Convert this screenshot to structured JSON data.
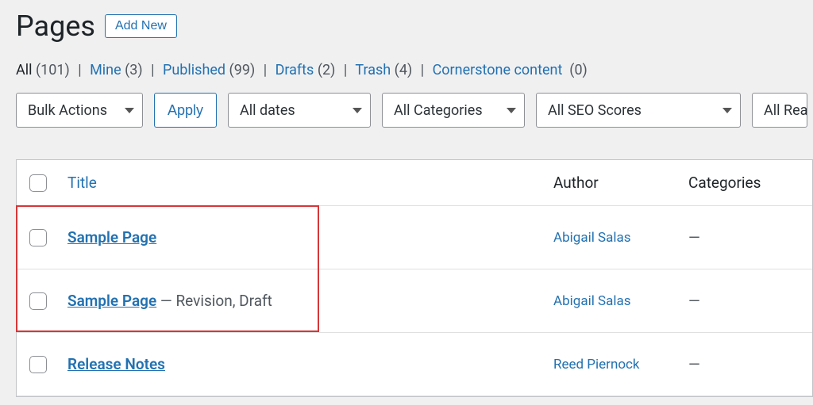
{
  "page": {
    "title": "Pages",
    "add_new": "Add New"
  },
  "filters": {
    "all": {
      "label": "All",
      "count": "(101)"
    },
    "mine": {
      "label": "Mine",
      "count": "(3)"
    },
    "published": {
      "label": "Published",
      "count": "(99)"
    },
    "drafts": {
      "label": "Drafts",
      "count": "(2)"
    },
    "trash": {
      "label": "Trash",
      "count": "(4)"
    },
    "cornerstone": {
      "label": "Cornerstone content",
      "count": "(0)"
    }
  },
  "toolbar": {
    "bulk": "Bulk Actions",
    "apply": "Apply",
    "dates": "All dates",
    "categories": "All Categories",
    "seo": "All SEO Scores",
    "read": "All Rea"
  },
  "columns": {
    "title": "Title",
    "author": "Author",
    "categories": "Categories"
  },
  "rows": {
    "0": {
      "title": "Sample Page",
      "status": "",
      "author": "Abigail Salas",
      "categories": "—"
    },
    "1": {
      "title": "Sample Page",
      "status": " — Revision, Draft",
      "author": "Abigail Salas",
      "categories": "—"
    },
    "2": {
      "title": "Release Notes",
      "status": "",
      "author": "Reed Piernock",
      "categories": "—"
    }
  }
}
